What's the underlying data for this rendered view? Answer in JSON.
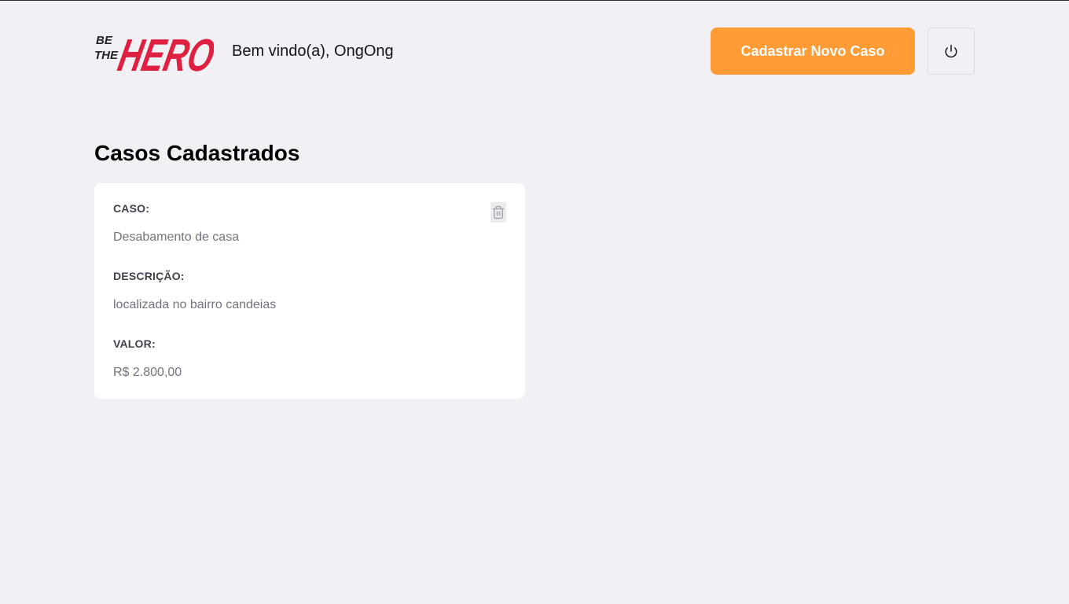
{
  "header": {
    "logo_text": [
      "BE",
      "THE",
      "HERO"
    ],
    "welcome_text": "Bem vindo(a), OngOng",
    "new_case_button": "Cadastrar Novo Caso",
    "logout_icon": "power-icon"
  },
  "main": {
    "title": "Casos Cadastrados",
    "cases": [
      {
        "case_label": "CASO:",
        "case_value": "Desabamento de casa",
        "description_label": "DESCRIÇÃO:",
        "description_value": "localizada no bairro candeias",
        "value_label": "VALOR:",
        "value_value": "R$ 2.800,00",
        "delete_icon": "trash-icon"
      }
    ]
  },
  "colors": {
    "background": "#f0f0f5",
    "accent": "#ff9c35",
    "brand_red": "#e02041",
    "label": "#41414d",
    "value": "#737380"
  }
}
